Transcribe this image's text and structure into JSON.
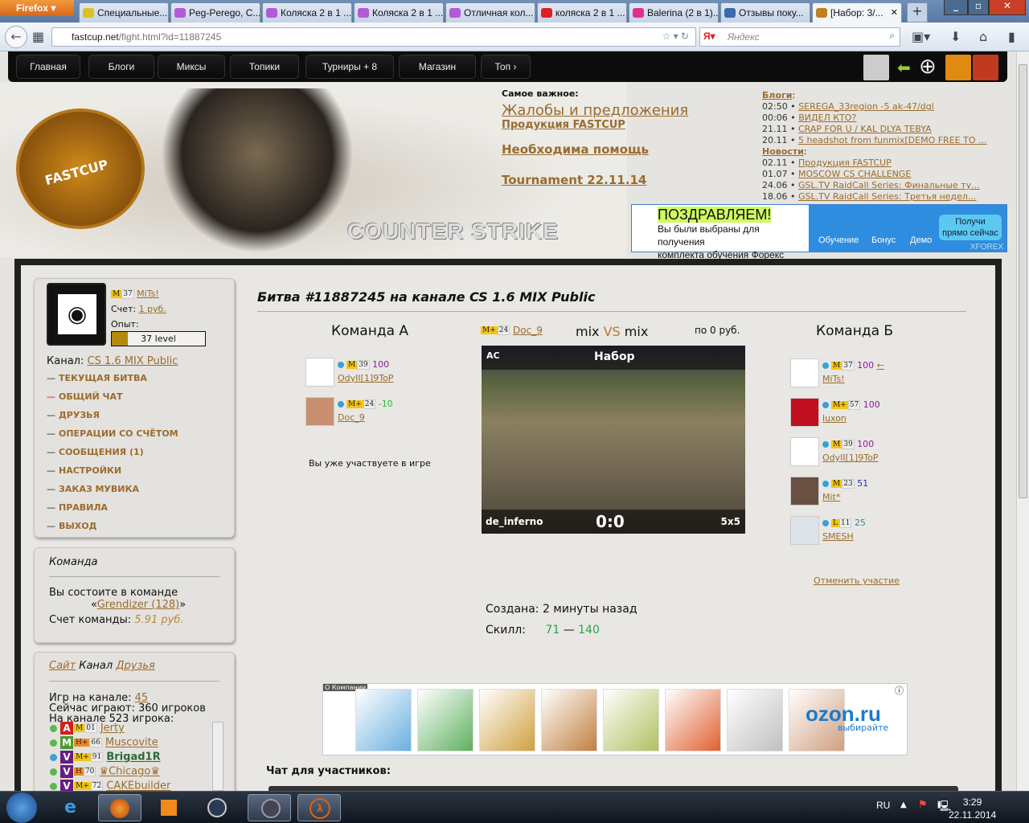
{
  "browser": {
    "menu_button": "Firefox",
    "tabs": [
      {
        "title": "Специальные...",
        "color": "#e0c020"
      },
      {
        "title": "Peg-Perego, С...",
        "color": "#b35ad8"
      },
      {
        "title": "Коляска 2 в 1 ...",
        "color": "#b35ad8"
      },
      {
        "title": "Коляска 2 в 1 ...",
        "color": "#b35ad8"
      },
      {
        "title": "Отличная кол...",
        "color": "#b35ad8"
      },
      {
        "title": "коляска 2 в 1 ...",
        "color": "#e02020"
      },
      {
        "title": "Balerina (2 в 1)...",
        "color": "#e0308a"
      },
      {
        "title": "Отзывы поку...",
        "color": "#3a6ab0"
      },
      {
        "title": "[Набор: 3/...",
        "color": "#c08020"
      }
    ],
    "url_host": "fastcup.net",
    "url_path": "/fight.html?id=11887245",
    "search_placeholder": "Яндекс"
  },
  "topmenu": [
    "Главная",
    "Блоги",
    "Миксы",
    "Топики",
    "Турниры + 8",
    "Магазин",
    "Топ"
  ],
  "banner": {
    "logo_text": "FASTCUP",
    "game_logo": "COUNTER STRIKE"
  },
  "important": {
    "heading": "Самое важное:",
    "links": [
      "Жалобы и предложения",
      "Продукция FASTCUP",
      "Необходима помощь",
      "Tournament 22.11.14"
    ]
  },
  "blogs": {
    "heading": "Блоги",
    "items": [
      {
        "time": "02:50",
        "title": "SEREGA_33region -5 ak-47/dgl"
      },
      {
        "time": "00:06",
        "title": "ВИДЕЛ КТО?"
      },
      {
        "time": "21.11",
        "title": "CRAP FOR U / KAL DLYA TEBYA"
      },
      {
        "time": "20.11",
        "title": "5 headshot from funmix[DEMO FREE TO ..."
      }
    ]
  },
  "news": {
    "heading": "Новости",
    "items": [
      {
        "time": "02.11",
        "title": "Продукция FASTCUP"
      },
      {
        "time": "01.07",
        "title": "MOSCOW CS CHALLENGE"
      },
      {
        "time": "24.06",
        "title": "GSL.TV RaidCall Series: Финальные ту..."
      },
      {
        "time": "18.06",
        "title": "GSL.TV RaidCall Series: Третья недел..."
      }
    ]
  },
  "ad": {
    "title": "ПОЗДРАВЛЯЕМ!",
    "line1": "Вы были выбраны для получения",
    "line2": "комплекта обучения Форекс",
    "steps": [
      "Обучение",
      "Бонус",
      "Демо"
    ],
    "cta1": "Получи",
    "cta2": "прямо сейчас",
    "brand": "XFOREX"
  },
  "profile": {
    "rank": "M",
    "level": "37",
    "name": "MiTs!",
    "balance_label": "Счет:",
    "balance": "1 руб.",
    "exp_label": "Опыт:",
    "exp_text": "37 level",
    "exp_fraction": 0.17,
    "channel_label": "Канал:",
    "channel": "CS 1.6 MIX Public"
  },
  "side_menu": [
    "ТЕКУЩАЯ БИТВА",
    "ОБЩИЙ ЧАТ",
    "ДРУЗЬЯ",
    "ОПЕРАЦИИ СО СЧЁТОМ",
    "СООБЩЕНИЯ (1)",
    "НАСТРОЙКИ",
    "ЗАКАЗ МУВИКА",
    "ПРАВИЛА",
    "ВЫХОД"
  ],
  "team_box": {
    "heading": "Команда",
    "text": "Вы состоите в команде",
    "team": "Grendizer",
    "team_count": "(128)",
    "score_label": "Счет команды:",
    "score": "5.91 руб."
  },
  "channel_box": {
    "tab_site": "Сайт",
    "tab_channel": "Канал",
    "tab_friends": "Друзья",
    "games_label": "Игр на канале:",
    "games": "45",
    "playing": "Сейчас играют: 360 игроков",
    "online": "На канале 523 игрока:",
    "players": [
      {
        "letter": "A",
        "lcolor": "#d02020",
        "rank": "M",
        "rcolor": "#f3c414",
        "level": "01",
        "name": "Jerty",
        "dot": "#5bb84a"
      },
      {
        "letter": "M",
        "lcolor": "#4a9a30",
        "rank": "H+",
        "rcolor": "#f08a20",
        "level": "66",
        "name": "Muscovite",
        "dot": "#5bb84a"
      },
      {
        "letter": "V",
        "lcolor": "#6a1a80",
        "rank": "M+",
        "rcolor": "#f3c414",
        "level": "91",
        "name": "Brigad1R",
        "dot": "#3aa0d8"
      },
      {
        "letter": "V",
        "lcolor": "#6a1a80",
        "rank": "H",
        "rcolor": "#f08a20",
        "level": "70",
        "name": "♛Chicago♛",
        "dot": "#5bb84a"
      },
      {
        "letter": "V",
        "lcolor": "#6a1a80",
        "rank": "M+",
        "rcolor": "#f3c414",
        "level": "72",
        "name": "CAKEbuilder",
        "dot": "#5bb84a"
      }
    ]
  },
  "battle": {
    "title": "Битва #11887245 на канале CS 1.6 MIX Public",
    "team_a": "Команда А",
    "team_b": "Команда Б",
    "creator_rank": "M+",
    "creator_level": "24",
    "creator": "Doc_9",
    "mode_left": "mix",
    "vs": "VS",
    "mode_right": "mix",
    "stake": "по 0 руб.",
    "already": "Вы уже участвуете в игре",
    "map_tag": "AC",
    "status": "Набор",
    "map": "de_inferno",
    "score": "0:0",
    "format": "5x5",
    "cancel": "Отменить участие",
    "created_label": "Создана:",
    "created": "2 минуты назад",
    "skill_label": "Скилл:",
    "skill_a": "71",
    "dash": "—",
    "skill_b": "140",
    "players_a": [
      {
        "rank": "M",
        "level": "39",
        "skill": "100",
        "scolor": "#8a1aa0",
        "name": "OdyII[1]9ToP",
        "avatar": "#fff"
      },
      {
        "rank": "M+",
        "level": "24",
        "skill": "-10",
        "scolor": "#20c040",
        "name": "Doc_9",
        "avatar": "#c89070"
      }
    ],
    "players_b": [
      {
        "rank": "M",
        "level": "37",
        "skill": "100",
        "scolor": "#8a1aa0",
        "name": "MiTs!",
        "avatar": "#fff",
        "arrow": "←"
      },
      {
        "rank": "M+",
        "level": "57",
        "skill": "100",
        "scolor": "#8a1aa0",
        "name": "luxon",
        "avatar": "#c01020"
      },
      {
        "rank": "M",
        "level": "39",
        "skill": "100",
        "scolor": "#8a1aa0",
        "name": "OdyII[1]9ToP",
        "avatar": "#fff"
      },
      {
        "rank": "M",
        "level": "23",
        "skill": "51",
        "scolor": "#2030c0",
        "name": "Mit*",
        "avatar": "#6a5040"
      },
      {
        "rank": "L",
        "level": "11",
        "skill": "25",
        "scolor": "#2090b0",
        "name": "SMESH",
        "avatar": "#dde2e8"
      }
    ]
  },
  "books_ad": {
    "label": "О Компании",
    "brand": "ozon.ru",
    "tagline": "выбирайте"
  },
  "chat_heading": "Чат для участников:",
  "taskbar": {
    "lang": "RU",
    "time": "3:29",
    "date": "22.11.2014"
  }
}
